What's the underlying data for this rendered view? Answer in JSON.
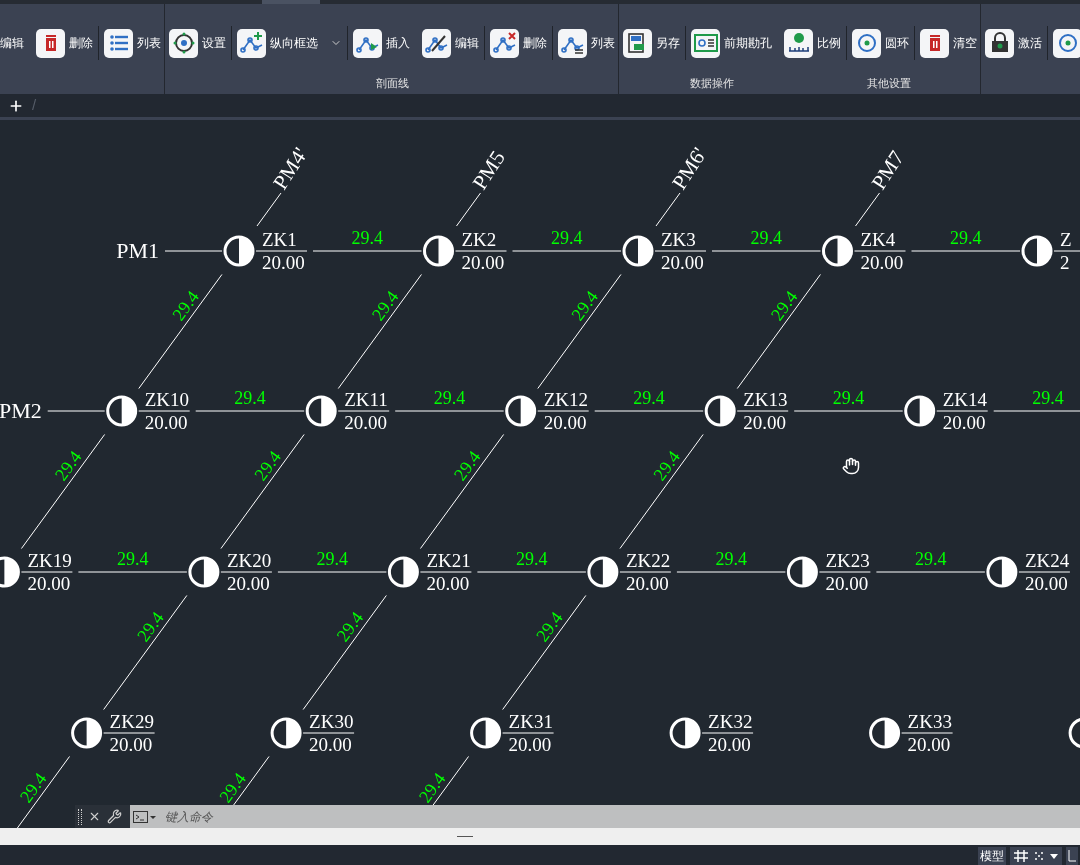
{
  "ribbon": {
    "panels": [
      {
        "groups": [
          [
            {
              "label": "编辑",
              "kind": "none"
            },
            {
              "label": "删除",
              "kind": "trash"
            }
          ],
          [
            {
              "label": "列表",
              "kind": "list"
            }
          ]
        ]
      },
      {
        "labels": [
          "剖面线"
        ],
        "groups": [
          [
            {
              "label": "设置",
              "kind": "target"
            }
          ],
          [
            {
              "label": "纵向框选",
              "kind": "curve-plus",
              "dropdown": true
            }
          ],
          [
            {
              "label": "插入",
              "kind": "curve-arrow"
            },
            {
              "label": "编辑",
              "kind": "curve-pen"
            }
          ],
          [
            {
              "label": "删除",
              "kind": "curve-x"
            }
          ],
          [
            {
              "label": "列表",
              "kind": "curve-list"
            }
          ]
        ]
      },
      {
        "labels": [
          "数据操作",
          "其他设置"
        ],
        "groups": [
          [
            {
              "label": "另存",
              "kind": "save"
            }
          ],
          [
            {
              "label": "前期勘孔",
              "kind": "card"
            },
            {
              "label": "比例",
              "kind": "scale"
            }
          ],
          [
            {
              "label": "圆环",
              "kind": "ring"
            }
          ],
          [
            {
              "label": "清空",
              "kind": "trash"
            }
          ]
        ]
      },
      {
        "groups": [
          [
            {
              "label": "激活",
              "kind": "lock"
            }
          ],
          [
            {
              "kind": "ring"
            }
          ]
        ]
      }
    ]
  },
  "file_tabs": {
    "separator": "/"
  },
  "drawing": {
    "rows": [
      {
        "label": "PM1",
        "spans": [
          "29.4",
          "29.4",
          "29.4",
          "29.4"
        ],
        "nodes": [
          {
            "name": "ZK1",
            "elevation": "20.00",
            "section": "PM4'",
            "down": "29.4"
          },
          {
            "name": "ZK2",
            "elevation": "20.00",
            "section": "PM5",
            "down": "29.4"
          },
          {
            "name": "ZK3",
            "elevation": "20.00",
            "section": "PM6'",
            "down": "29.4"
          },
          {
            "name": "ZK4",
            "elevation": "20.00",
            "section": "PM7",
            "down": "29.4"
          },
          {
            "name": "Z",
            "elevation": "2"
          }
        ]
      },
      {
        "label": "PM2",
        "spans": [
          "29.4",
          "29.4",
          "29.4",
          "29.4",
          "29.4"
        ],
        "nodes": [
          {
            "name": "ZK10",
            "elevation": "20.00",
            "down": "29.4"
          },
          {
            "name": "ZK11",
            "elevation": "20.00",
            "down": "29.4"
          },
          {
            "name": "ZK12",
            "elevation": "20.00",
            "down": "29.4"
          },
          {
            "name": "ZK13",
            "elevation": "20.00",
            "down": "29.4"
          },
          {
            "name": "ZK14",
            "elevation": "20.00"
          }
        ]
      },
      {
        "spans": [
          "29.4",
          "29.4",
          "29.4",
          "29.4",
          "29.4"
        ],
        "nodes": [
          {
            "name": "ZK19",
            "elevation": "20.00"
          },
          {
            "name": "ZK20",
            "elevation": "20.00",
            "down": "29.4"
          },
          {
            "name": "ZK21",
            "elevation": "20.00",
            "down": "29.4"
          },
          {
            "name": "ZK22",
            "elevation": "20.00",
            "down": "29.4"
          },
          {
            "name": "ZK23",
            "elevation": "20.00"
          },
          {
            "name": "ZK24",
            "elevation": "20.00"
          }
        ]
      },
      {
        "nodes": [
          {
            "kind": "labeled",
            "name": "ZK29",
            "elevation": "20.00",
            "down": "29.4"
          },
          {
            "kind": "labeled",
            "name": "ZK30",
            "elevation": "20.00",
            "down": "29.4"
          },
          {
            "kind": "labeled",
            "name": "ZK31",
            "elevation": "20.00",
            "down": "29.4"
          },
          {
            "kind": "labeled",
            "name": "ZK32",
            "elevation": "20.00"
          },
          {
            "kind": "labeled",
            "name": "ZK33",
            "elevation": "20.00"
          },
          {
            "kind": "stub"
          }
        ]
      }
    ]
  },
  "command_line": {
    "placeholder": "键入命令"
  },
  "status_bar": {
    "model": "模型"
  }
}
